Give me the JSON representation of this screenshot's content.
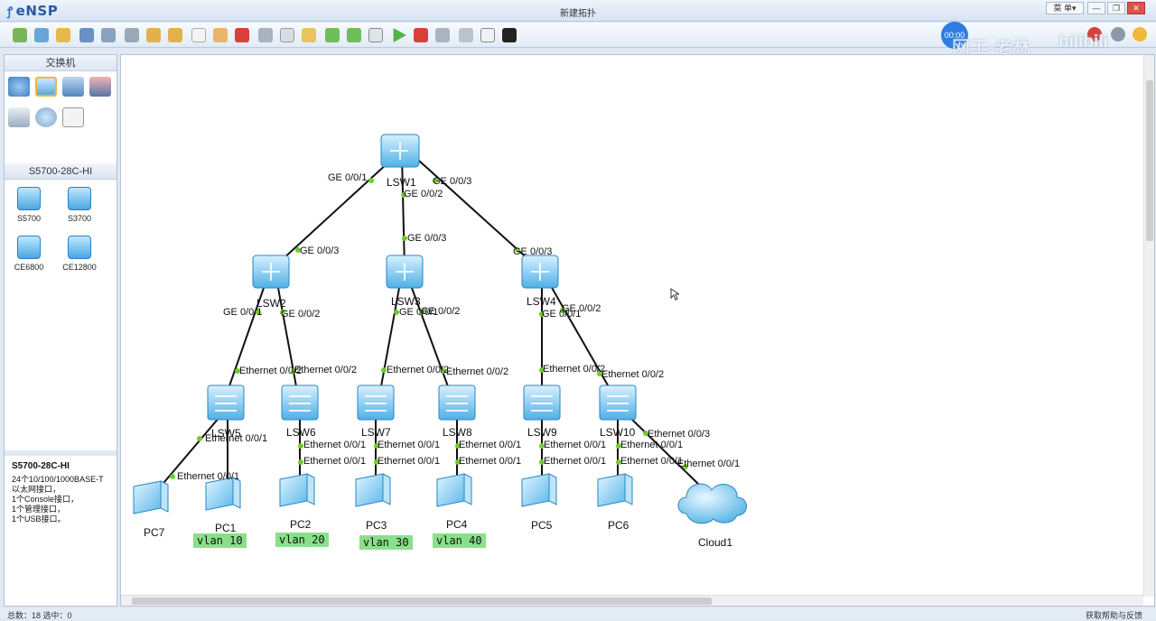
{
  "app": {
    "logo": "eNSP",
    "window_title": "新建拓扑",
    "menu_label": "菜 单▾"
  },
  "watermark": {
    "timer": "00:00",
    "text": "网工-老林",
    "brand": "bilibili"
  },
  "left_panel": {
    "category_title": "交换机",
    "model_title": "S5700-28C-HI",
    "devices": [
      {
        "label": "S5700"
      },
      {
        "label": "S3700"
      },
      {
        "label": "CE6800"
      },
      {
        "label": "CE12800"
      }
    ],
    "description_title": "S5700-28C-HI",
    "description_lines": [
      "24个10/100/1000BASE-T以太网接口，",
      "1个Console接口，",
      "1个管理接口，",
      "1个USB接口。"
    ]
  },
  "topology": {
    "nodes": [
      {
        "name": "LSW1"
      },
      {
        "name": "LSW2"
      },
      {
        "name": "LSW3"
      },
      {
        "name": "LSW4"
      },
      {
        "name": "LSW5"
      },
      {
        "name": "LSW6"
      },
      {
        "name": "LSW7"
      },
      {
        "name": "LSW8"
      },
      {
        "name": "LSW9"
      },
      {
        "name": "LSW10"
      },
      {
        "name": "PC7"
      },
      {
        "name": "PC1"
      },
      {
        "name": "PC2"
      },
      {
        "name": "PC3"
      },
      {
        "name": "PC4"
      },
      {
        "name": "PC5"
      },
      {
        "name": "PC6"
      },
      {
        "name": "Cloud1"
      }
    ],
    "port_labels": [
      "GE 0/0/1",
      "GE 0/0/2",
      "GE 0/0/3",
      "GE 0/0/3",
      "GE 0/0/3",
      "GE 0/0/3",
      "GE 0/0/1",
      "GE 0/0/2",
      "GE 0/0/1",
      "GE 0/0/2",
      "GE 0/0/1",
      "GE 0/0/2",
      "Ethernet 0/0/2",
      "Ethernet 0/0/2",
      "Ethernet 0/0/2",
      "Ethernet 0/0/2",
      "Ethernet 0/0/2",
      "Ethernet 0/0/2",
      "Ethernet 0/0/1",
      "Ethernet 0/0/1",
      "Ethernet 0/0/1",
      "Ethernet 0/0/1",
      "Ethernet 0/0/1",
      "Ethernet 0/0/1",
      "Ethernet 0/0/1",
      "Ethernet 0/0/1",
      "Ethernet 0/0/1",
      "Ethernet 0/0/1",
      "Ethernet 0/0/1",
      "Ethernet 0/0/1",
      "Ethernet 0/0/1",
      "Ethernet 0/0/1",
      "Ethernet 0/0/3",
      "Ethernet 0/0/1"
    ],
    "vlans": [
      "vlan 10",
      "vlan 20",
      "vlan 30",
      "vlan 40"
    ]
  },
  "status": {
    "left": "总数：18  选中：0",
    "right": "获取帮助与反馈"
  }
}
